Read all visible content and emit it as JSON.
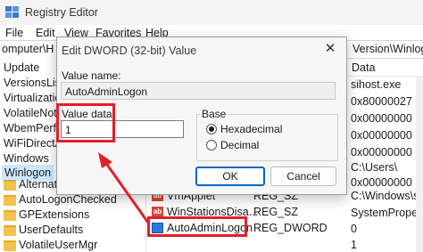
{
  "window": {
    "title": "Registry Editor",
    "menu": [
      "File",
      "Edit",
      "View",
      "Favorites",
      "Help"
    ],
    "address_left": "omputer\\H",
    "address_right": "Version\\Winlogon"
  },
  "tree": {
    "items": [
      "Update",
      "VersionsList",
      "Virtualizatio",
      "VolatileNotifi",
      "WbemPerf",
      "WiFiDirectA",
      "Windows",
      "Winlogon"
    ],
    "selected": "Winlogon",
    "subfolders": [
      "Alternate",
      "AutoLogonChecked",
      "GPExtensions",
      "UserDefaults",
      "VolatileUserMgr"
    ]
  },
  "values_pane": {
    "data_header": "Data",
    "data_values": [
      "sihost.exe",
      "0x80000027 (",
      "0x00000000 (",
      "0x00000000 (",
      "0x00000000 (",
      "C:\\Users\\",
      "0x00000000 (",
      "C:\\Windows\\s",
      "SystemProper",
      "0",
      "1"
    ],
    "rows": [
      {
        "name": "VmApplet",
        "type": "REG_SZ"
      },
      {
        "name": "WinStationsDisa...",
        "type": "REG_SZ"
      },
      {
        "name": "AutoAdminLogon",
        "type": "REG_DWORD"
      }
    ]
  },
  "dialog": {
    "title": "Edit DWORD (32-bit) Value",
    "close_glyph": "✕",
    "value_name_label": "Value name:",
    "value_name": "AutoAdminLogon",
    "value_data_label": "Value data:",
    "value_data": "1",
    "base_label": "Base",
    "base_options": [
      "Hexadecimal",
      "Decimal"
    ],
    "base_selected": "Hexadecimal",
    "ok_label": "OK",
    "cancel_label": "Cancel"
  },
  "annotation_color": "#e0202a"
}
